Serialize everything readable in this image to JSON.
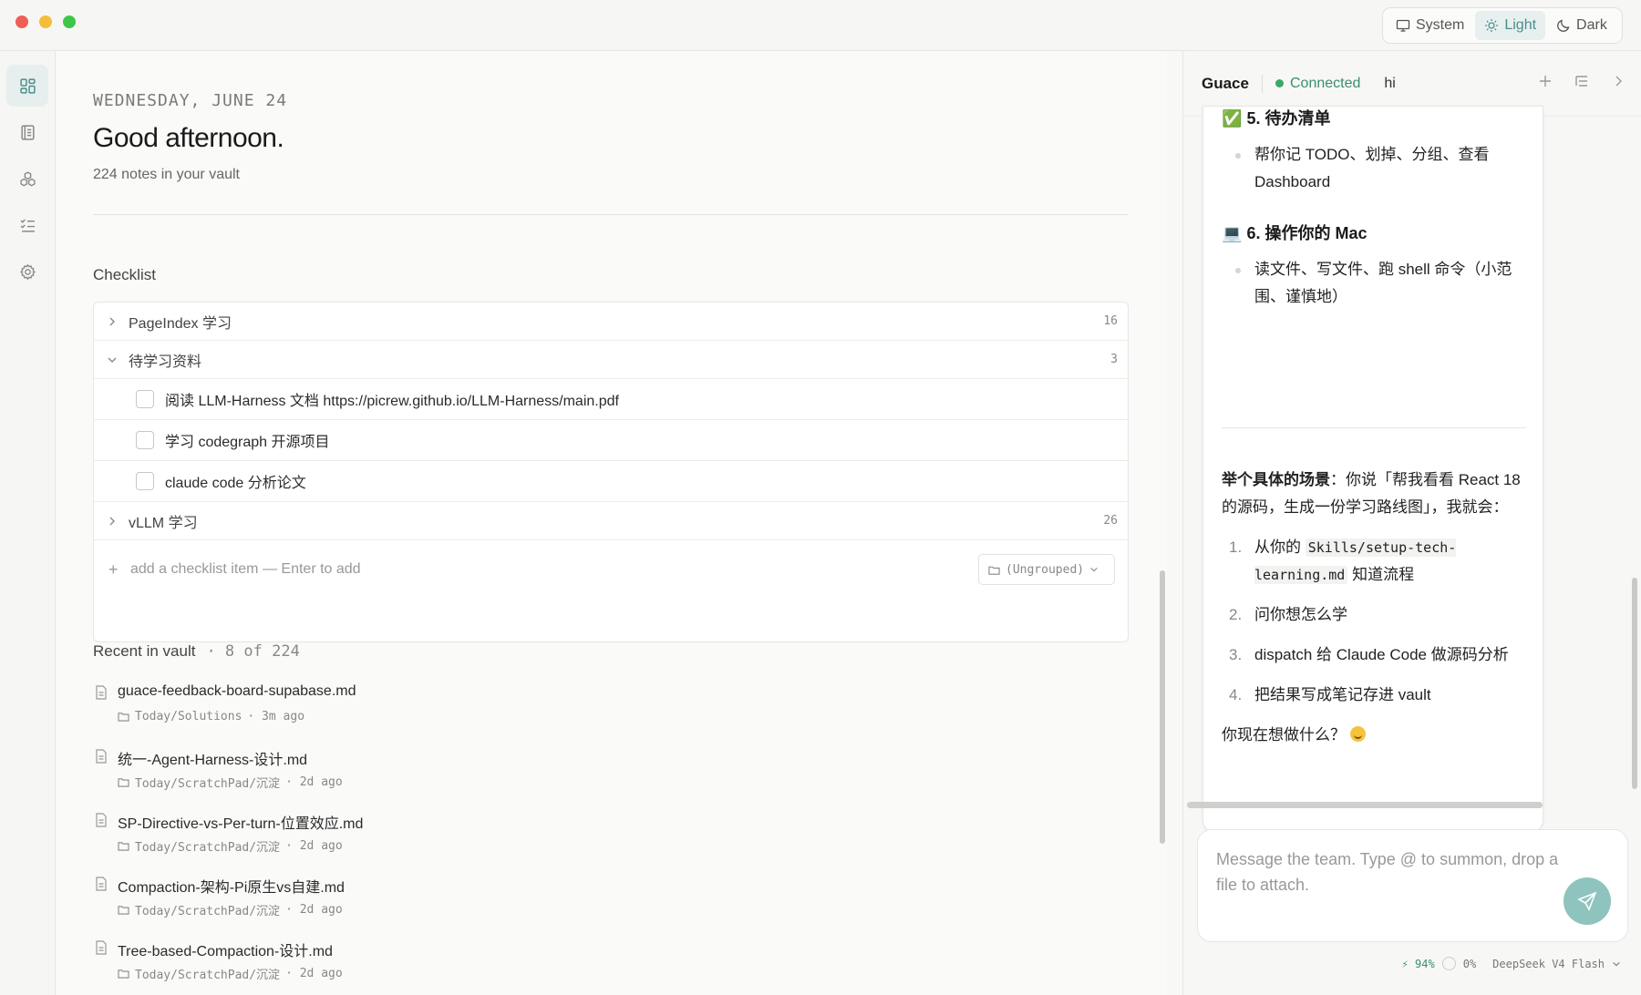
{
  "window": {
    "theme_options": [
      {
        "label": "System",
        "icon": "monitor-icon"
      },
      {
        "label": "Light",
        "icon": "sun-icon"
      },
      {
        "label": "Dark",
        "icon": "moon-icon"
      }
    ],
    "theme_selected": "Light",
    "accent_color": "#4a8f8a"
  },
  "rail": {
    "items": [
      {
        "name": "dashboard",
        "icon": "grid-icon",
        "active": true
      },
      {
        "name": "notes",
        "icon": "notebook-icon",
        "active": false
      },
      {
        "name": "skills",
        "icon": "cubes-icon",
        "active": false
      },
      {
        "name": "checklist",
        "icon": "list-check-icon",
        "active": false
      },
      {
        "name": "settings",
        "icon": "gear-icon",
        "active": false
      }
    ]
  },
  "main": {
    "date": "WEDNESDAY, JUNE 24",
    "greeting": "Good afternoon.",
    "subtitle": "224 notes in your vault",
    "checklist": {
      "title": "Checklist",
      "groups": [
        {
          "label": "PageIndex 学习",
          "count": "16",
          "expanded": false
        },
        {
          "label": "待学习资料",
          "count": "3",
          "expanded": true,
          "items": [
            {
              "label": "阅读 LLM-Harness 文档 https://picrew.github.io/LLM-Harness/main.pdf",
              "checked": false
            },
            {
              "label": "学习 codegraph 开源项目",
              "checked": false
            },
            {
              "label": "claude code 分析论文",
              "checked": false
            }
          ]
        },
        {
          "label": "vLLM 学习",
          "count": "26",
          "expanded": false
        }
      ],
      "add_placeholder": "add a checklist item — Enter to add",
      "group_select": "(Ungrouped)"
    },
    "recent": {
      "title": "Recent in vault",
      "count": "· 8 of 224",
      "notes": [
        {
          "title": "guace-feedback-board-supabase.md",
          "folder": "Today/Solutions",
          "age": "· 3m ago"
        },
        {
          "title": "统一-Agent-Harness-设计.md",
          "folder": "Today/ScratchPad/沉淀",
          "age": "· 2d ago"
        },
        {
          "title": "SP-Directive-vs-Per-turn-位置效应.md",
          "folder": "Today/ScratchPad/沉淀",
          "age": "· 2d ago"
        },
        {
          "title": "Compaction-架构-Pi原生vs自建.md",
          "folder": "Today/ScratchPad/沉淀",
          "age": "· 2d ago"
        },
        {
          "title": "Tree-based-Compaction-设计.md",
          "folder": "Today/ScratchPad/沉淀",
          "age": "· 2d ago"
        }
      ]
    }
  },
  "panel": {
    "agent_name": "Guace",
    "status": "Connected",
    "status_color": "#3aa76d",
    "session": "hi",
    "message": {
      "h5_emoji": "✅",
      "h5": "5. 待办清单",
      "h5_bullet": "帮你记 TODO、划掉、分组、查看 Dashboard",
      "h6_emoji": "💻",
      "h6": "6. 操作你的 Mac",
      "h6_bullet": "读文件、写文件、跑 shell 命令（小范围、谨慎地）",
      "scenario_bold": "举个具体的场景",
      "scenario_rest": "：你说「帮我看看 React 18 的源码，生成一份学习路线图」，我就会：",
      "steps": [
        {
          "num": "1.",
          "pre": "从你的 ",
          "code": "Skills/setup-tech-learning.md",
          "post": " 知道流程"
        },
        {
          "num": "2.",
          "pre": "问你想怎么学",
          "code": "",
          "post": ""
        },
        {
          "num": "3.",
          "pre": "dispatch 给 Claude Code 做源码分析",
          "code": "",
          "post": ""
        },
        {
          "num": "4.",
          "pre": "把结果写成笔记存进 vault",
          "code": "",
          "post": ""
        }
      ],
      "closing": "你现在想做什么？"
    },
    "composer_placeholder": "Message the team. Type @ to summon, drop a file to attach.",
    "status_bar": {
      "battery": "⚡ 94%",
      "usage": "0%",
      "model": "DeepSeek V4 Flash"
    }
  }
}
